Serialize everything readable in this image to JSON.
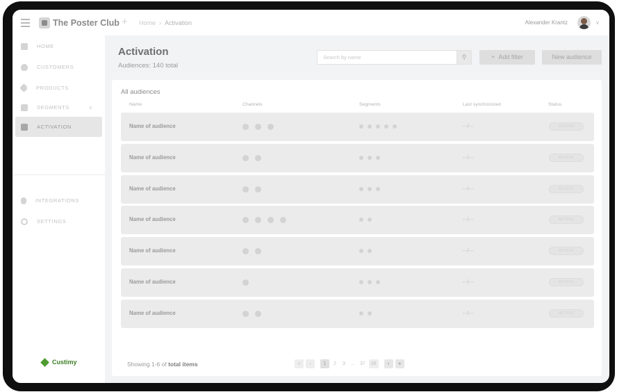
{
  "app": {
    "title": "The Poster Club"
  },
  "breadcrumb": {
    "home": "Home",
    "separator": "›",
    "current": "Activation"
  },
  "user": {
    "name": "Alexander Krantz"
  },
  "sidebar": {
    "items": [
      {
        "label": "HOME"
      },
      {
        "label": "CUSTOMERS"
      },
      {
        "label": "PRODUCTS"
      },
      {
        "label": "SEGMENTS"
      },
      {
        "label": "ACTIVATION"
      },
      {
        "label": "INTEGRATIONS"
      },
      {
        "label": "SETTINGS"
      }
    ],
    "active": "ACTIVATION",
    "brand": "Custimy"
  },
  "page": {
    "title": "Activation",
    "subtitle": "Audiences: 140 total"
  },
  "search": {
    "placeholder": "Search by name"
  },
  "buttons": {
    "add_filter": "Add filter",
    "new_audience": "New audience"
  },
  "table": {
    "title": "All audiences",
    "columns": [
      "Name",
      "Channels",
      "Segments",
      "Last synchronized",
      "Status"
    ],
    "rows": [
      {
        "name": "Name of audience",
        "channels": 3,
        "segments": 5,
        "last": "--/--",
        "status": "ACTIVE"
      },
      {
        "name": "Name of audience",
        "channels": 2,
        "segments": 3,
        "last": "--/--",
        "status": "ACTIVE"
      },
      {
        "name": "Name of audience",
        "channels": 2,
        "segments": 3,
        "last": "--/--",
        "status": "ACTIVE"
      },
      {
        "name": "Name of audience",
        "channels": 4,
        "segments": 2,
        "last": "--/--",
        "status": "ACTIVE"
      },
      {
        "name": "Name of audience",
        "channels": 2,
        "segments": 2,
        "last": "--/--",
        "status": "ACTIVE"
      },
      {
        "name": "Name of audience",
        "channels": 1,
        "segments": 3,
        "last": "--/--",
        "status": "ACTIVE"
      },
      {
        "name": "Name of audience",
        "channels": 2,
        "segments": 2,
        "last": "--/--",
        "status": "ACTIVE"
      }
    ]
  },
  "footer": {
    "showing": "Showing 1-6 of",
    "total": "total items"
  },
  "pagination": {
    "first": "«",
    "prev": "‹",
    "pages": [
      "1",
      "2",
      "3",
      "...",
      "37",
      "38"
    ],
    "current": "1",
    "next": "›",
    "last": "»"
  }
}
